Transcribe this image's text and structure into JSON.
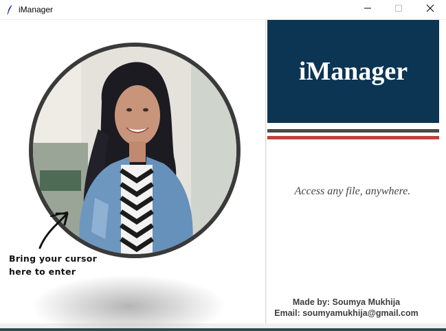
{
  "window": {
    "title": "iManager",
    "controls": {
      "minimize_icon": "minimize-icon",
      "maximize_icon": "maximize-icon",
      "close_icon": "close-icon"
    }
  },
  "left": {
    "hint_line1": "Bring your cursor",
    "hint_line2": "here to enter",
    "photo_icon": "profile-photo"
  },
  "right": {
    "banner_title": "iManager",
    "tagline": "Access any file, anywhere.",
    "made_by": "Made by: Soumya Mukhija",
    "email": "Email: soumyamukhija@gmail.com"
  },
  "colors": {
    "banner": "#0c3554",
    "stripe_dark": "#4a4a4a",
    "stripe_red": "#c2403c",
    "taskbar": "#2f4b4e"
  }
}
